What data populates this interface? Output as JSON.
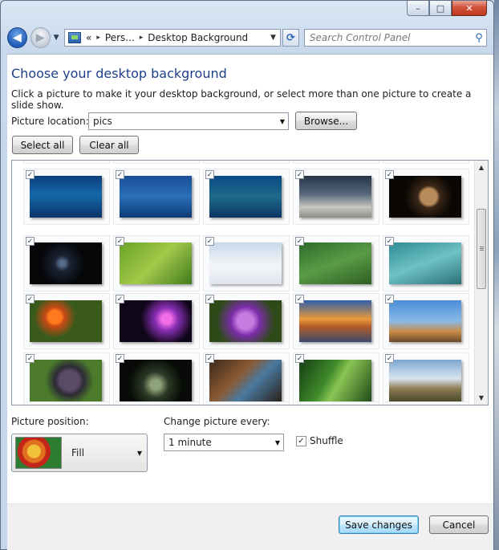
{
  "window": {
    "caption": {
      "minimize_glyph": "–",
      "maximize_glyph": "□",
      "close_glyph": "✕"
    }
  },
  "nav": {
    "back_glyph": "◀",
    "forward_glyph": "▶",
    "address": {
      "overflow": "«",
      "crumbs": [
        "Pers...",
        "Desktop Background"
      ],
      "separator": "▸"
    },
    "refresh_glyph": "⟳",
    "search": {
      "placeholder": "Search Control Panel"
    }
  },
  "page": {
    "title": "Choose your desktop background",
    "description": "Click a picture to make it your desktop background, or select more than one picture to create a slide show.",
    "location_label": "Picture location:",
    "location_value": "pics",
    "browse_label": "Browse...",
    "select_all_label": "Select all",
    "clear_all_label": "Clear all"
  },
  "gallery": {
    "tiles": [
      {
        "name": "fish-school",
        "checked": true,
        "bg": "linear-gradient(180deg,#0c3f7c 0%,#1469a9 45%,#0a3468 100%)"
      },
      {
        "name": "manta-ray",
        "checked": true,
        "bg": "linear-gradient(180deg,#1a4f96 0%,#2a6fb9 50%,#0d3a74 100%)"
      },
      {
        "name": "sea-turtle",
        "checked": true,
        "bg": "linear-gradient(180deg,#0b4a86 0%,#1e6a8a 50%,#0c3563 100%)"
      },
      {
        "name": "stormy-beach",
        "checked": true,
        "bg": "linear-gradient(180deg,#253346 0%,#5a6b7e 45%,#c9c7bf 75%,#8c8d88 100%)"
      },
      {
        "name": "golden-drop",
        "checked": true,
        "bg": "radial-gradient(circle at 55% 50%,#b98a5a 0 10px,#3b2717 14px,#0a0704 30px)"
      },
      {
        "name": "dark-spiral",
        "checked": true,
        "bg": "radial-gradient(circle at 45% 50%,#5a6d89 0 3px,#1a2233 10px,#050608 28px)"
      },
      {
        "name": "wasp-leaf",
        "checked": true,
        "bg": "linear-gradient(135deg,#6aa428 0%,#a3c94a 50%,#3f7a1e 100%)"
      },
      {
        "name": "snow-cabin",
        "checked": true,
        "bg": "linear-gradient(180deg,#c7d7ea 0%,#f4f6f8 55%,#dfe6ee 100%)"
      },
      {
        "name": "leaf-drops",
        "checked": true,
        "bg": "linear-gradient(160deg,#2f6a2a 0%,#5a9b46 50%,#2d5e22 100%)"
      },
      {
        "name": "teal-texture",
        "checked": true,
        "bg": "linear-gradient(160deg,#2f8a93 0%,#6ec2c4 50%,#2a7076 100%)"
      },
      {
        "name": "orange-flowers",
        "checked": true,
        "bg": "radial-gradient(circle at 35% 40%,#ff7a1f 0 8px,#c84a14 12px,#3a5a1c 26px)"
      },
      {
        "name": "purple-light",
        "checked": true,
        "bg": "radial-gradient(circle at 65% 45%,#f26de6 0 6px,#8a2fb6 14px,#100619 32px)"
      },
      {
        "name": "purple-crocus",
        "checked": true,
        "bg": "radial-gradient(circle at 50% 50%,#c77ae0 0 10px,#7a2da8 18px,#2e4a19 36px)"
      },
      {
        "name": "beach-sunset",
        "checked": true,
        "bg": "linear-gradient(180deg,#2f5ea8 0%,#e99a3b 45%,#b85e2a 62%,#3c4b6c 100%)"
      },
      {
        "name": "rock-formation",
        "checked": true,
        "bg": "linear-gradient(180deg,#4b8ed8 0%,#8ab9e6 50%,#c98b45 75%,#6a4a2a 100%)"
      },
      {
        "name": "grapes",
        "checked": true,
        "bg": "radial-gradient(circle at 55% 50%,#5a4a66 0 12px,#2d2a35 18px,#4a7a2a 30px)"
      },
      {
        "name": "night-forest",
        "checked": true,
        "bg": "radial-gradient(circle at 50% 60%,#8fa37a 0 6px,#2c3a26 16px,#070a06 34px)"
      },
      {
        "name": "steampunk-room",
        "checked": true,
        "bg": "linear-gradient(135deg,#3a2a1c 0%,#8a5a34 40%,#4a7aa0 60%,#2a2018 100%)"
      },
      {
        "name": "grass-blades",
        "checked": true,
        "bg": "linear-gradient(120deg,#163d14 0%,#3f8a2a 40%,#8ac454 55%,#1d4a16 100%)"
      },
      {
        "name": "castle-hill",
        "checked": true,
        "bg": "linear-gradient(180deg,#7ba6cf 0%,#d9e6ef 45%,#8a7a52 70%,#4b4a2a 100%)"
      }
    ],
    "check_glyph": "✓"
  },
  "position": {
    "label": "Picture position:",
    "value": "Fill"
  },
  "interval": {
    "label": "Change picture every:",
    "value": "1 minute"
  },
  "shuffle": {
    "label": "Shuffle",
    "checked": true
  },
  "footer": {
    "save_label": "Save changes",
    "cancel_label": "Cancel"
  }
}
